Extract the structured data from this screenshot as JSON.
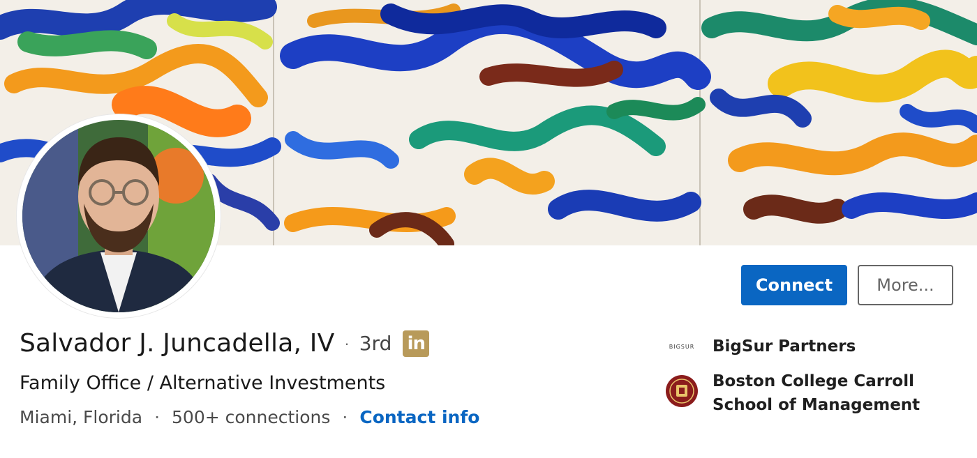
{
  "profile": {
    "name": "Salvador J. Juncadella, IV",
    "degree": "3rd",
    "badge": "in",
    "headline": "Family Office / Alternative Investments",
    "location": "Miami, Florida",
    "connections": "500+ connections",
    "contact_info": "Contact info"
  },
  "actions": {
    "connect_label": "Connect",
    "more_label": "More..."
  },
  "side": {
    "items": [
      {
        "logo_text": "BIGSUR",
        "label": "BigSur Partners",
        "icon": "bigsur-logo"
      },
      {
        "label": "Boston College Carroll School of Management",
        "icon": "boston-college-seal"
      }
    ]
  },
  "colors": {
    "accent": "#0a66c2",
    "badge": "#b89a5a",
    "seal": "#8b1c1c"
  }
}
